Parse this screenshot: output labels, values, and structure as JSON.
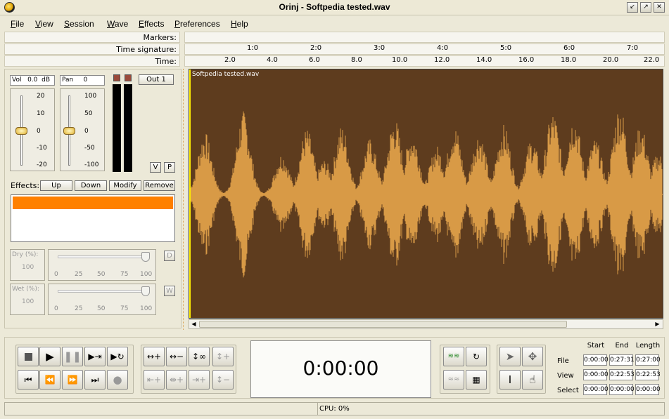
{
  "window": {
    "title": "Orinj - Softpedia tested.wav",
    "controls": [
      "↙",
      "↗",
      "✕"
    ]
  },
  "menu": [
    {
      "label": "File",
      "ul": "F",
      "rest": "ile"
    },
    {
      "label": "View",
      "ul": "V",
      "rest": "iew"
    },
    {
      "label": "Session",
      "ul": "S",
      "rest": "ession"
    },
    {
      "label": "Wave",
      "ul": "W",
      "rest": "ave"
    },
    {
      "label": "Effects",
      "ul": "E",
      "rest": "ffects"
    },
    {
      "label": "Preferences",
      "ul": "P",
      "rest": "references"
    },
    {
      "label": "Help",
      "ul": "H",
      "rest": "elp"
    }
  ],
  "ruler": {
    "markers_label": "Markers:",
    "time_signature_label": "Time signature:",
    "time_label": "Time:",
    "bar_ticks": [
      "1:0",
      "2:0",
      "3:0",
      "4:0",
      "5:0",
      "6:0",
      "7:0"
    ],
    "time_ticks": [
      "2.0",
      "4.0",
      "6.0",
      "8.0",
      "10.0",
      "12.0",
      "14.0",
      "16.0",
      "18.0",
      "20.0",
      "22.0"
    ]
  },
  "track": {
    "vol_label": "Vol",
    "vol_value": "0.0",
    "vol_unit": "dB",
    "pan_label": "Pan",
    "pan_value": "0",
    "output": "Out 1",
    "vol_scale": [
      "20",
      "10",
      "0",
      "-10",
      "-20"
    ],
    "pan_scale": [
      "100",
      "50",
      "0",
      "-50",
      "-100"
    ],
    "v_button": "V",
    "p_button": "P"
  },
  "effects": {
    "label": "Effects:",
    "buttons": {
      "up": "Up",
      "down": "Down",
      "modify": "Modify",
      "remove": "Remove"
    },
    "selected_item": ""
  },
  "dry": {
    "label": "Dry (%):",
    "value": "100",
    "scale": [
      "0",
      "25",
      "50",
      "75",
      "100"
    ],
    "button": "D"
  },
  "wet": {
    "label": "Wet (%):",
    "value": "100",
    "scale": [
      "0",
      "25",
      "50",
      "75",
      "100"
    ],
    "button": "W"
  },
  "wave": {
    "filename": "Softpedia tested.wav",
    "color": "#D89A46",
    "background": "#5E3C1E"
  },
  "transport": {
    "time_display": "0:00:00"
  },
  "selection": {
    "headers": [
      "Start",
      "End",
      "Length"
    ],
    "rows": [
      {
        "label": "File",
        "start": "0:00:00",
        "end": "0:27:31",
        "length": "0:27:00"
      },
      {
        "label": "View",
        "start": "0:00:00",
        "end": "0:22:53",
        "length": "0:22:53"
      },
      {
        "label": "Select",
        "start": "0:00:00",
        "end": "0:00:00",
        "length": "0:00:00"
      }
    ]
  },
  "status": {
    "cpu": "CPU: 0%"
  }
}
